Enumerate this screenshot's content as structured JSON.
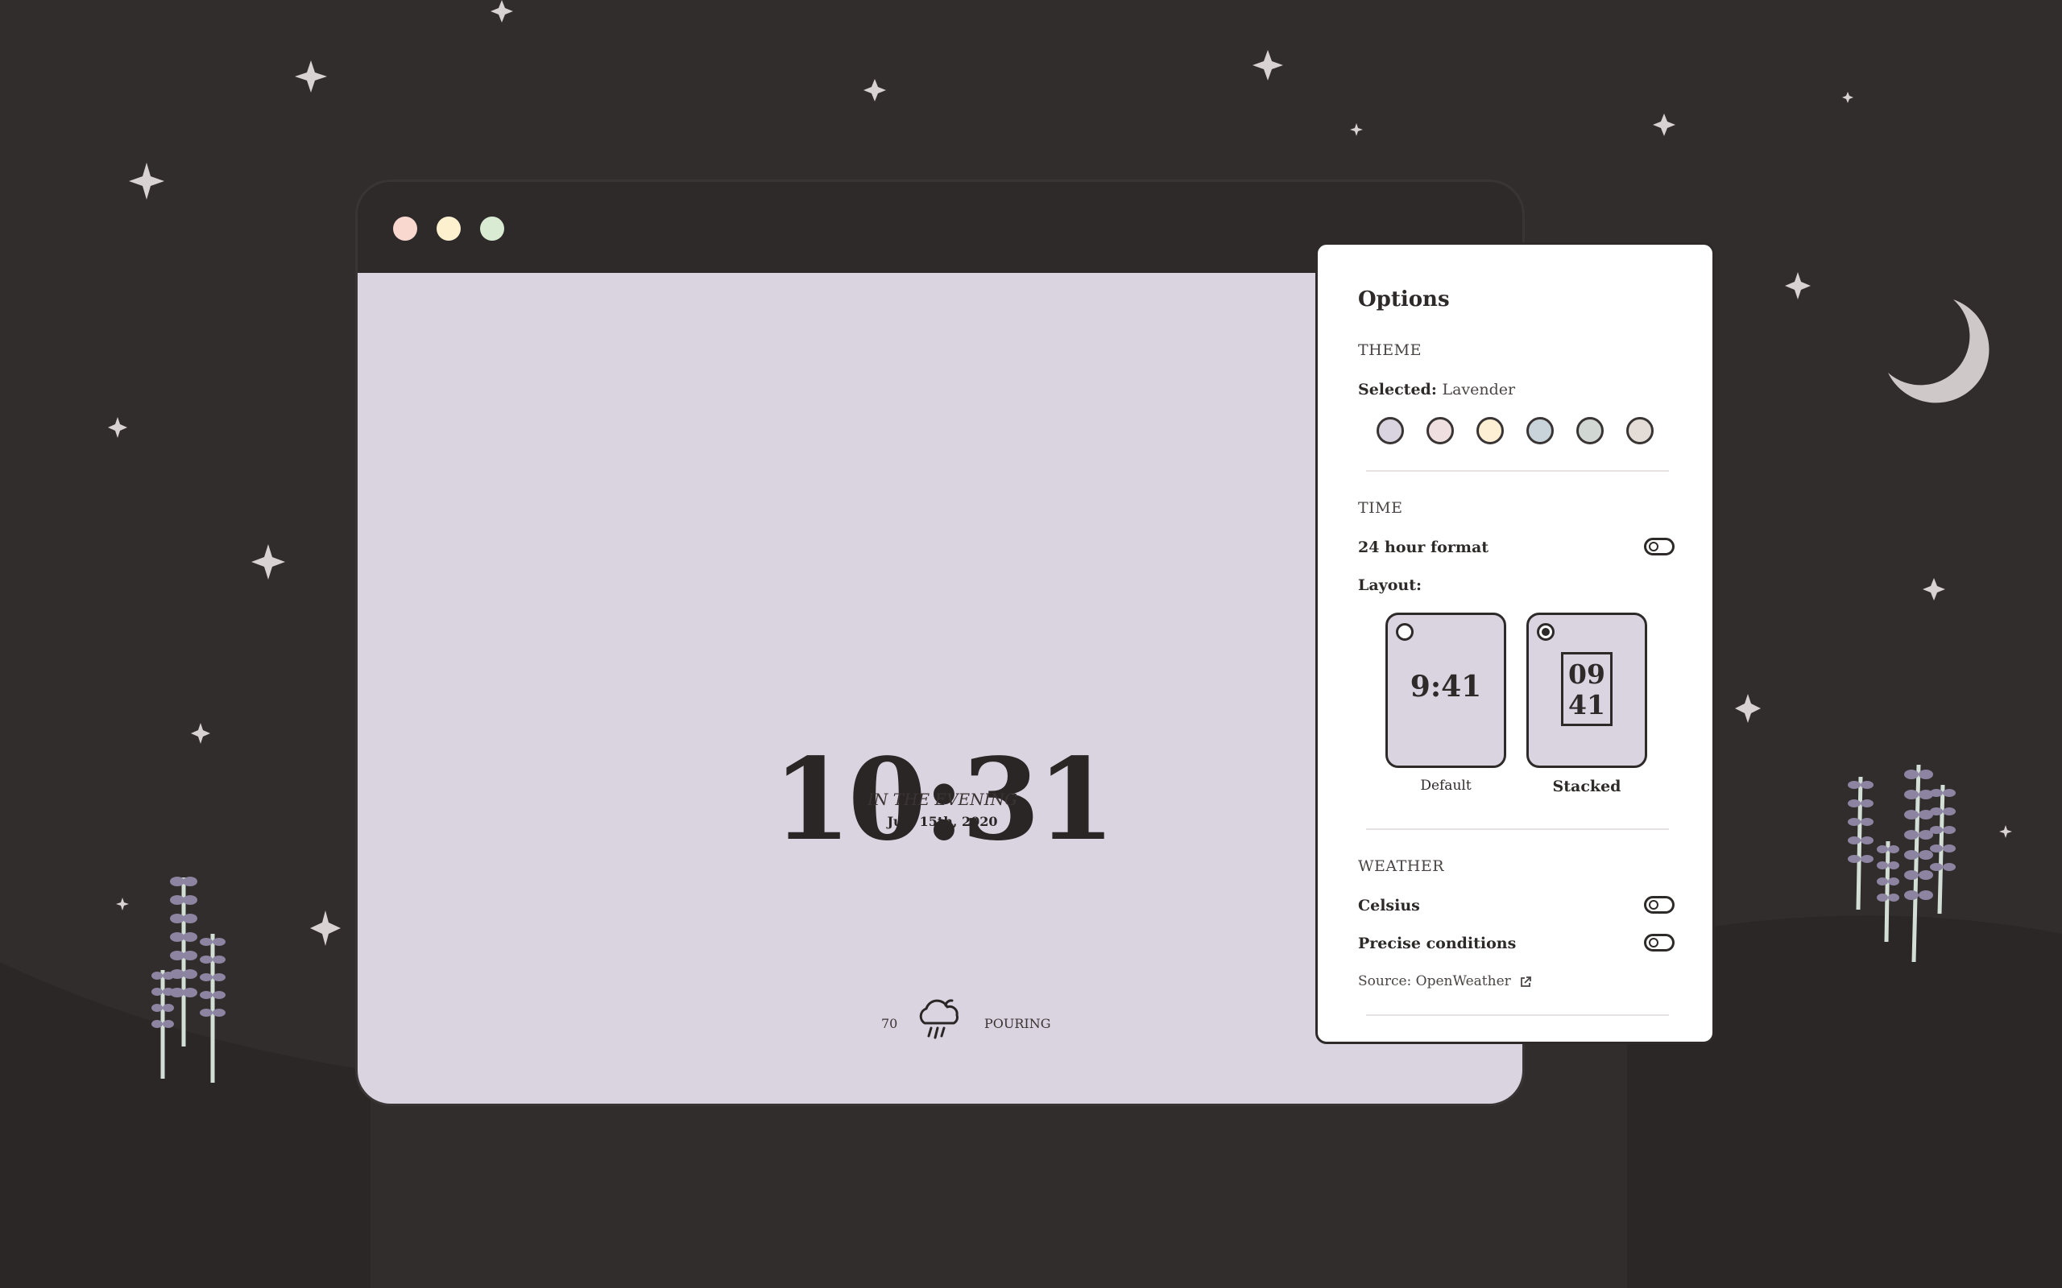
{
  "window": {
    "controls": [
      "close",
      "minimize",
      "maximize"
    ],
    "clock": {
      "time": "10:31",
      "period": "IN THE EVENING",
      "date": "July 15th, 2020"
    },
    "weather": {
      "temperature": "70",
      "icon": "rain-cloud-icon",
      "condition": "POURING"
    }
  },
  "options": {
    "title": "Options",
    "theme": {
      "section_label": "THEME",
      "selected_label": "Selected",
      "selected_sep": ":",
      "selected_value": "Lavender",
      "swatches": [
        "#dad4e0",
        "#f0dfe1",
        "#fcefd3",
        "#c9d3da",
        "#d1d7d2",
        "#e4dcd6"
      ]
    },
    "time": {
      "section_label": "TIME",
      "format_label": "24 hour format",
      "format_enabled": false,
      "layout_label": "Layout:",
      "layouts": [
        {
          "preview": "9:41",
          "caption": "Default",
          "selected": false
        },
        {
          "preview_top": "09",
          "preview_bottom": "41",
          "caption": "Stacked",
          "selected": true
        }
      ]
    },
    "weather": {
      "section_label": "WEATHER",
      "celsius_label": "Celsius",
      "celsius_enabled": false,
      "precise_label": "Precise conditions",
      "precise_enabled": false,
      "source_prefix": "Source:",
      "source_name": "OpenWeather",
      "source_icon": "external-link-icon"
    }
  },
  "scene": {
    "background": "#312d2c",
    "moon": "crescent-moon",
    "accent_lavender": "#dad4e0"
  }
}
